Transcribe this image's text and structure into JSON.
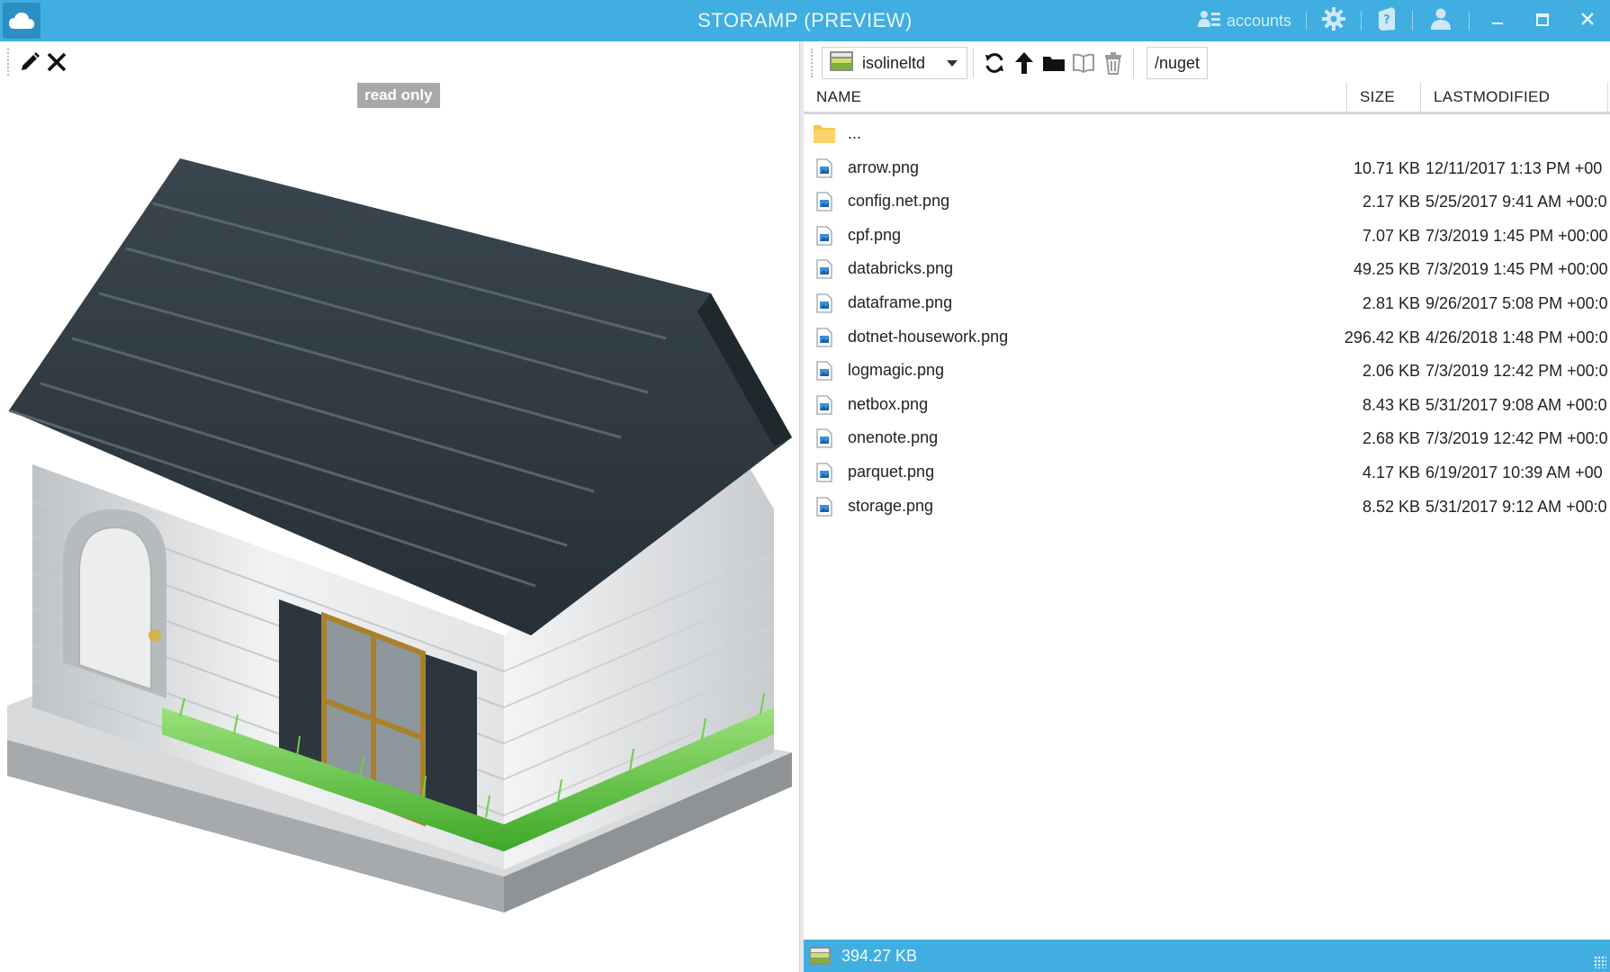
{
  "titlebar": {
    "title": "STORAMP (PREVIEW)",
    "accounts_label": "accounts",
    "app_icon": "cloud-icon",
    "icons": [
      "accounts-icon",
      "gear-icon",
      "help-book-icon",
      "users-icon"
    ],
    "window_controls": [
      "minimize-icon",
      "maximize-icon",
      "close-icon"
    ]
  },
  "left_pane": {
    "toolbar_icons": [
      "pencil-icon",
      "close-icon"
    ],
    "read_only_badge": "read only",
    "preview_image": "house-image"
  },
  "right_pane": {
    "account_selector": {
      "value": "isolineltd",
      "icon": "storage-account-icon"
    },
    "toolbar_icons": [
      "refresh-icon",
      "up-arrow-icon",
      "new-folder-icon",
      "open-book-icon",
      "trash-icon"
    ],
    "path": "/nuget",
    "columns": [
      "NAME",
      "SIZE",
      "LASTMODIFIED"
    ],
    "parent_row": {
      "name": "...",
      "icon": "folder-icon"
    },
    "files": [
      {
        "name": "arrow.png",
        "size": "10.71 KB",
        "modified": "12/11/2017 1:13 PM +00"
      },
      {
        "name": "config.net.png",
        "size": "2.17 KB",
        "modified": "5/25/2017 9:41 AM +00:0"
      },
      {
        "name": "cpf.png",
        "size": "7.07 KB",
        "modified": "7/3/2019 1:45 PM +00:00"
      },
      {
        "name": "databricks.png",
        "size": "49.25 KB",
        "modified": "7/3/2019 1:45 PM +00:00"
      },
      {
        "name": "dataframe.png",
        "size": "2.81 KB",
        "modified": "9/26/2017 5:08 PM +00:0"
      },
      {
        "name": "dotnet-housework.png",
        "size": "296.42 KB",
        "modified": "4/26/2018 1:48 PM +00:0"
      },
      {
        "name": "logmagic.png",
        "size": "2.06 KB",
        "modified": "7/3/2019 12:42 PM +00:0"
      },
      {
        "name": "netbox.png",
        "size": "8.43 KB",
        "modified": "5/31/2017 9:08 AM +00:0"
      },
      {
        "name": "onenote.png",
        "size": "2.68 KB",
        "modified": "7/3/2019 12:42 PM +00:0"
      },
      {
        "name": "parquet.png",
        "size": "4.17 KB",
        "modified": "6/19/2017 10:39 AM +00"
      },
      {
        "name": "storage.png",
        "size": "8.52 KB",
        "modified": "5/31/2017 9:12 AM +00:0"
      }
    ]
  },
  "statusbar": {
    "total_size": "394.27 KB",
    "icon": "storage-account-icon"
  },
  "colors": {
    "accent": "#40aee0",
    "roof": "#2f3b42",
    "folder": "#f8c74c",
    "badge": "#a8a8a8"
  }
}
